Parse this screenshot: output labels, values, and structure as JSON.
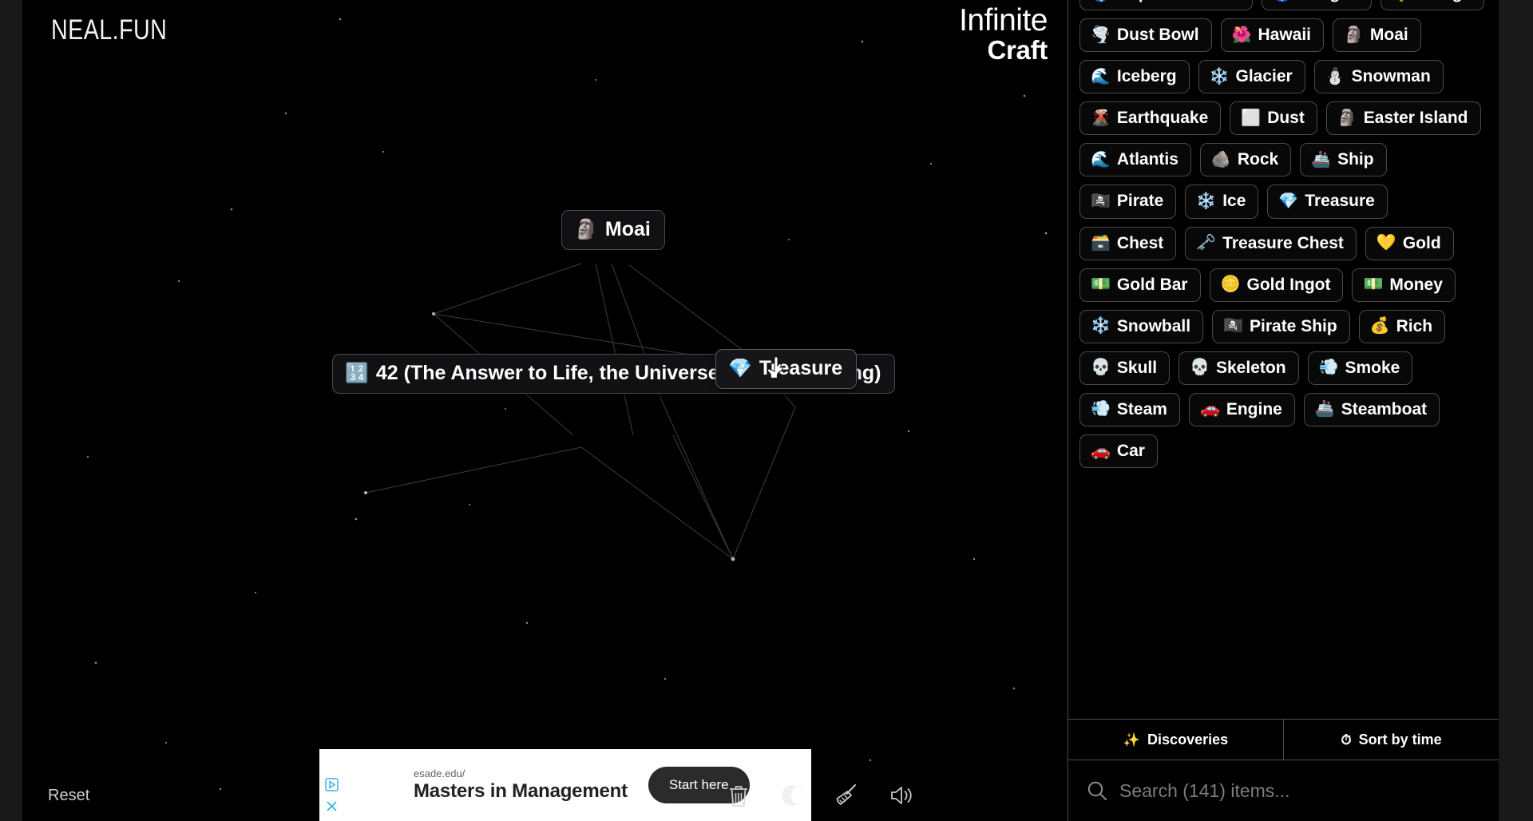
{
  "brand": {
    "logo": "NEAL.FUN"
  },
  "game_title": {
    "line1": "Infinite",
    "line2": "Craft"
  },
  "canvas": {
    "reset_label": "Reset",
    "nodes": [
      {
        "name": "moai",
        "emoji": "🗿",
        "label": "Moai"
      },
      {
        "name": "forty-two",
        "emoji": "🔢",
        "label": "42 (The Answer to Life, the Universe, and Everything)"
      },
      {
        "name": "treasure",
        "emoji": "💎",
        "label": "Treasure"
      }
    ],
    "cursor": "pointing-hand-cursor",
    "tools": [
      {
        "name": "trash-icon",
        "title": "Delete"
      },
      {
        "name": "moon-icon",
        "title": "Dark mode"
      },
      {
        "name": "broom-icon",
        "title": "Clear"
      },
      {
        "name": "speaker-icon",
        "title": "Sound"
      }
    ]
  },
  "ad": {
    "url": "esade.edu/",
    "headline": "Masters in Management",
    "cta": "Start here",
    "adchoices_icon": "adchoices-triangle-icon",
    "close_icon": "close-icon"
  },
  "sidebar": {
    "items": [
      {
        "emoji": "🌎",
        "label": "Supercontinent"
      },
      {
        "emoji": "🌍",
        "label": "Pangea"
      },
      {
        "emoji": "🌵",
        "label": "Mirage"
      },
      {
        "emoji": "🌪️",
        "label": "Dust Bowl"
      },
      {
        "emoji": "🌺",
        "label": "Hawaii"
      },
      {
        "emoji": "🗿",
        "label": "Moai"
      },
      {
        "emoji": "🌊",
        "label": "Iceberg"
      },
      {
        "emoji": "❄️",
        "label": "Glacier"
      },
      {
        "emoji": "⛄",
        "label": "Snowman"
      },
      {
        "emoji": "🌋",
        "label": "Earthquake"
      },
      {
        "emoji": "⬜",
        "label": "Dust"
      },
      {
        "emoji": "🗿",
        "label": "Easter Island"
      },
      {
        "emoji": "🌊",
        "label": "Atlantis"
      },
      {
        "emoji": "🪨",
        "label": "Rock"
      },
      {
        "emoji": "🚢",
        "label": "Ship"
      },
      {
        "emoji": "🏴‍☠️",
        "label": "Pirate"
      },
      {
        "emoji": "❄️",
        "label": "Ice"
      },
      {
        "emoji": "💎",
        "label": "Treasure"
      },
      {
        "emoji": "🗃️",
        "label": "Chest"
      },
      {
        "emoji": "🗝️",
        "label": "Treasure Chest"
      },
      {
        "emoji": "💛",
        "label": "Gold"
      },
      {
        "emoji": "💵",
        "label": "Gold Bar"
      },
      {
        "emoji": "🪙",
        "label": "Gold Ingot"
      },
      {
        "emoji": "💵",
        "label": "Money"
      },
      {
        "emoji": "❄️",
        "label": "Snowball"
      },
      {
        "emoji": "🏴‍☠️",
        "label": "Pirate Ship"
      },
      {
        "emoji": "💰",
        "label": "Rich"
      },
      {
        "emoji": "💀",
        "label": "Skull"
      },
      {
        "emoji": "💀",
        "label": "Skeleton"
      },
      {
        "emoji": "💨",
        "label": "Smoke"
      },
      {
        "emoji": "💨",
        "label": "Steam"
      },
      {
        "emoji": "🚗",
        "label": "Engine"
      },
      {
        "emoji": "🚢",
        "label": "Steamboat"
      },
      {
        "emoji": "🚗",
        "label": "Car"
      }
    ],
    "tabs": [
      {
        "name": "discoveries",
        "icon": "✨",
        "label": "Discoveries"
      },
      {
        "name": "sort-by-time",
        "icon": "⏱",
        "label": "Sort by time"
      }
    ],
    "search_placeholder": "Search (141) items...",
    "search_value": ""
  },
  "colors": {
    "background": "#000000",
    "chrome_edge": "#191919",
    "node_border": "#4a4a4d",
    "divider": "#4d4d4d",
    "text": "#ffffff",
    "muted_text": "#7d7d7d"
  }
}
